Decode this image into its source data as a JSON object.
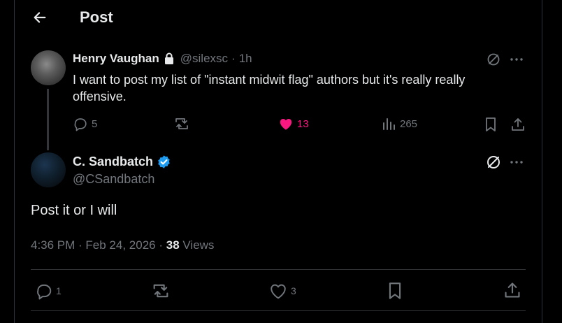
{
  "header": {
    "title": "Post"
  },
  "parent_post": {
    "author_name": "Henry Vaughan",
    "handle": "@silexsc",
    "separator": "·",
    "time": "1h",
    "text": "I want to post my list of \"instant midwit flag\" authors but it's really really offensive.",
    "replies": "5",
    "likes": "13",
    "views": "265",
    "liked": true
  },
  "main_post": {
    "author_name": "C. Sandbatch",
    "handle": "@CSandbatch",
    "verified": true,
    "text": "Post it or I will",
    "timestamp": "4:36 PM · Feb 24, 2026 ·",
    "views_count": "38",
    "views_label": "Views",
    "replies": "1",
    "likes": "3"
  },
  "colors": {
    "like_active": "#f91880",
    "verified_blue": "#1d9bf0",
    "muted": "#71767b"
  },
  "icons": [
    "back-arrow-icon",
    "lock-icon",
    "grok-icon",
    "more-icon",
    "reply-icon",
    "retweet-icon",
    "heart-icon",
    "views-icon",
    "bookmark-icon",
    "share-icon",
    "verified-badge-icon"
  ]
}
